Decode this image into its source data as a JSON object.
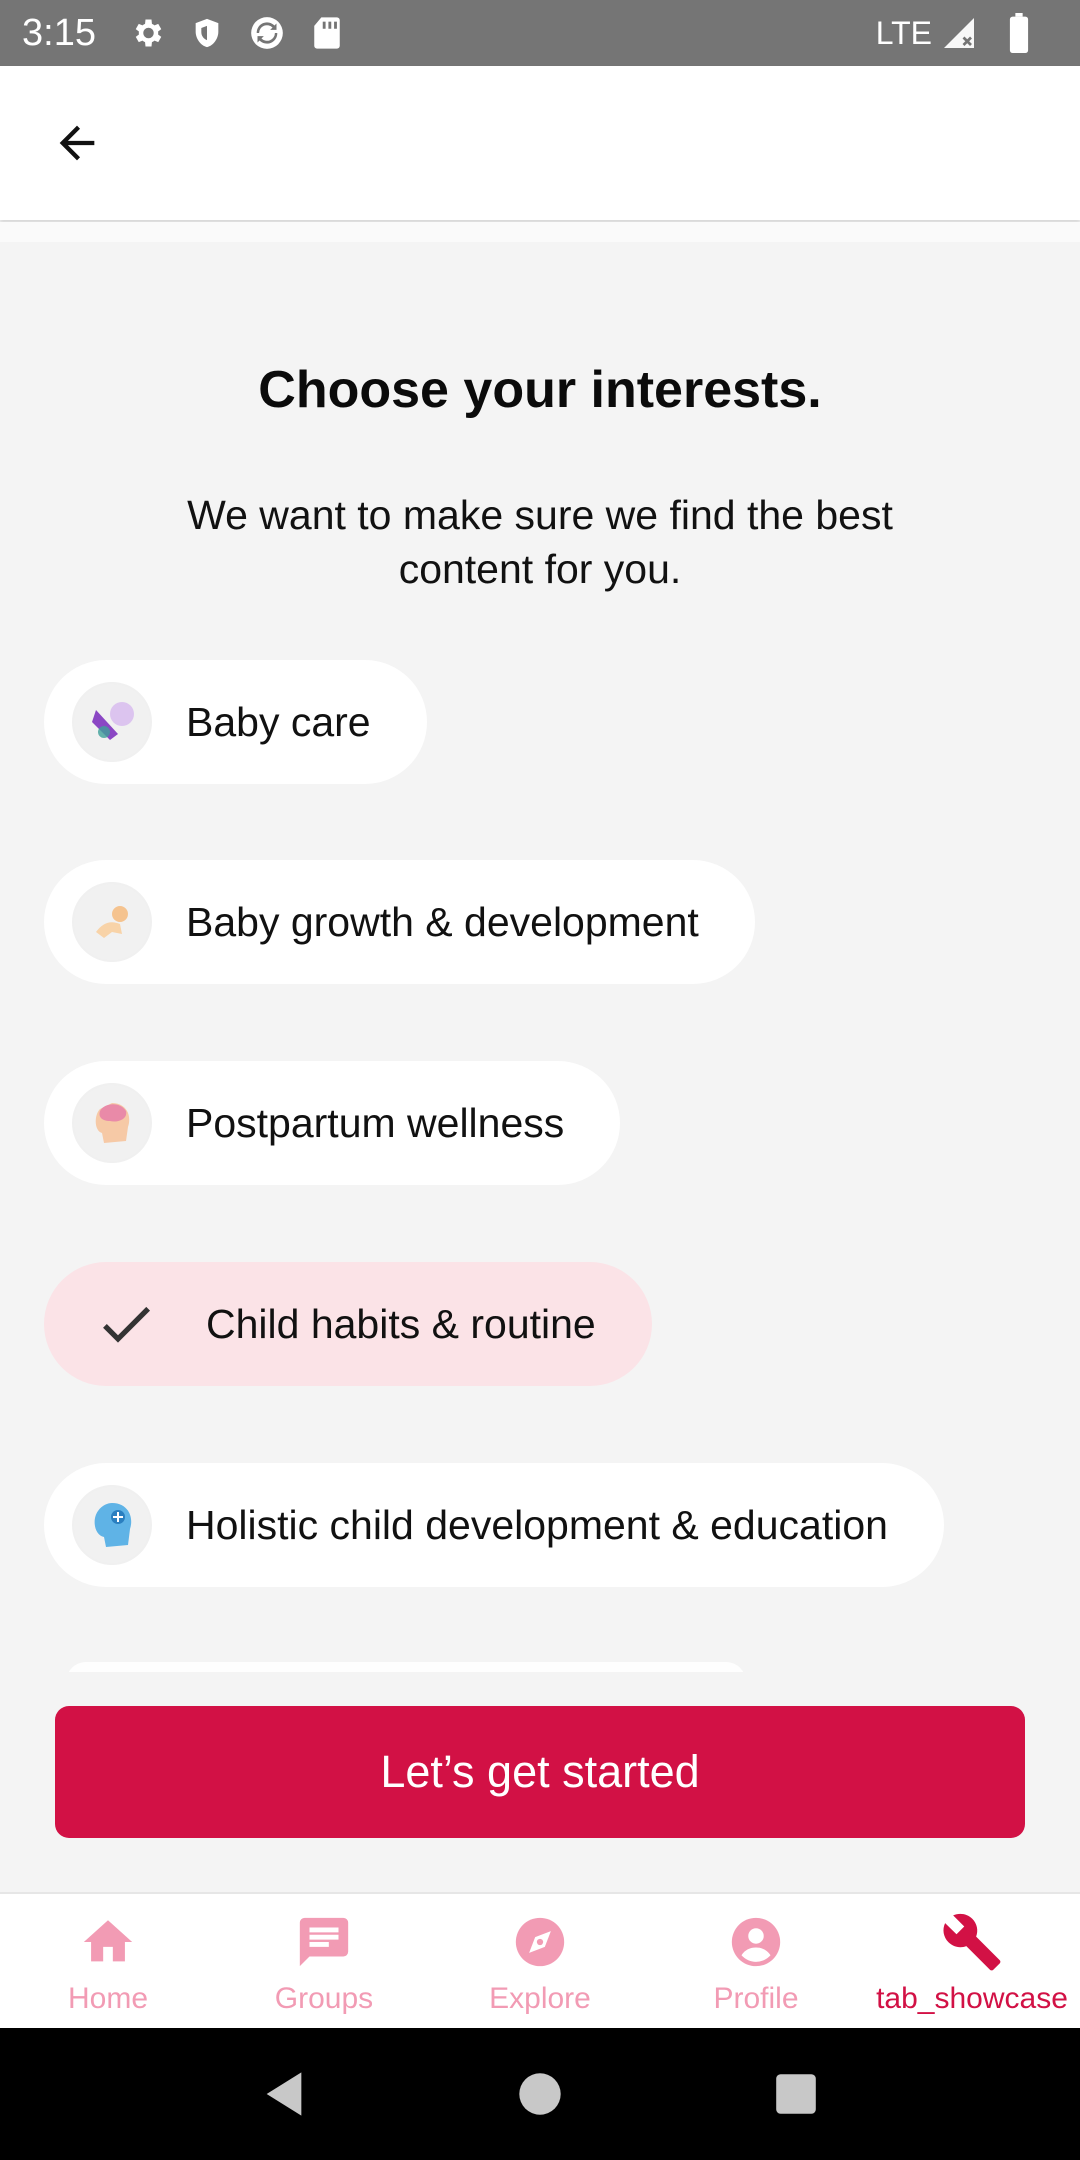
{
  "status_bar": {
    "time": "3:15",
    "left_icons": [
      "gear-icon",
      "shield-icon",
      "sync-icon",
      "sd-card-icon"
    ],
    "network": "LTE",
    "right_icons": [
      "signal-icon",
      "battery-icon"
    ]
  },
  "app_bar": {
    "back_icon": "arrow-left-icon"
  },
  "content": {
    "title": "Choose your interests.",
    "subtitle": "We want to make sure we find the best content for you."
  },
  "interests": [
    {
      "label": "Baby care",
      "icon": "baby-care-icon",
      "selected": false
    },
    {
      "label": "Baby growth & development",
      "icon": "baby-growth-icon",
      "selected": false
    },
    {
      "label": "Postpartum wellness",
      "icon": "postpartum-icon",
      "selected": false
    },
    {
      "label": "Child habits & routine",
      "icon": "check-icon",
      "selected": true
    },
    {
      "label": "Holistic child development & education",
      "icon": "child-education-icon",
      "selected": false
    }
  ],
  "cta": {
    "label": "Let’s get started"
  },
  "bottom_nav": {
    "items": [
      {
        "label": "Home",
        "icon": "home-icon",
        "active": false
      },
      {
        "label": "Groups",
        "icon": "chat-icon",
        "active": false
      },
      {
        "label": "Explore",
        "icon": "compass-icon",
        "active": false
      },
      {
        "label": "Profile",
        "icon": "person-icon",
        "active": false
      },
      {
        "label": "tab_showcase",
        "icon": "wrench-icon",
        "active": true
      }
    ]
  },
  "colors": {
    "accent": "#d21145",
    "accent_light": "#f29bb4",
    "selected_chip": "#fbe3e7",
    "background": "#f4f4f4",
    "status_bar": "#757575"
  }
}
